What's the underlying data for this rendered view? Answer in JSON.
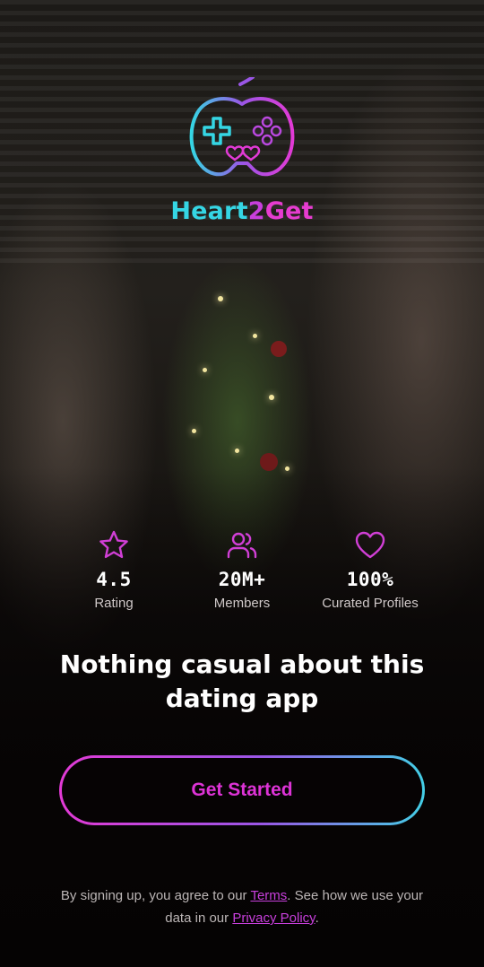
{
  "app": {
    "brand_part1": "Heart",
    "brand_part2": "2",
    "brand_part3": "Get",
    "logo_icon": "gamepad-heart-icon"
  },
  "stats": [
    {
      "icon": "star-icon",
      "value": "4.5",
      "label": "Rating"
    },
    {
      "icon": "users-icon",
      "value": "20M+",
      "label": "Members"
    },
    {
      "icon": "heart-icon",
      "value": "100%",
      "label": "Curated Profiles"
    }
  ],
  "headline": {
    "line1": "Nothing casual about this",
    "line2": "dating app"
  },
  "cta": {
    "label": "Get Started"
  },
  "legal": {
    "text1": "By signing up, you agree to our ",
    "terms_link": "Terms",
    "text2": ". See how we use your data in our ",
    "privacy_link": "Privacy Policy",
    "text3": "."
  },
  "colors": {
    "accent_pink": "#e23ad6",
    "accent_purple": "#9a56e6",
    "accent_cyan": "#43cfe6",
    "background": "#0a0707"
  }
}
